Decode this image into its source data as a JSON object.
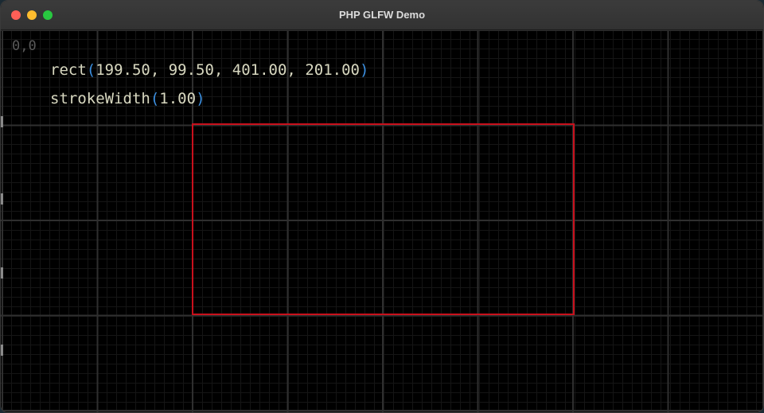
{
  "window": {
    "title": "PHP GLFW Demo"
  },
  "canvas": {
    "origin_label": "0,0",
    "rect_call": {
      "fn": "rect",
      "open": "(",
      "args": "199.50, 99.50, 401.00, 201.00",
      "close": ")"
    },
    "stroke_call": {
      "fn": "strokeWidth",
      "open": "(",
      "args": "1.00",
      "close": ")"
    }
  },
  "colors": {
    "rect_stroke": "#c8101c",
    "paren": "#3b8fe0",
    "code_text": "#d8d8c0",
    "grid_major": "#2f2f2f"
  },
  "icons": {
    "close": "close-icon",
    "minimize": "minimize-icon",
    "zoom": "zoom-icon"
  }
}
